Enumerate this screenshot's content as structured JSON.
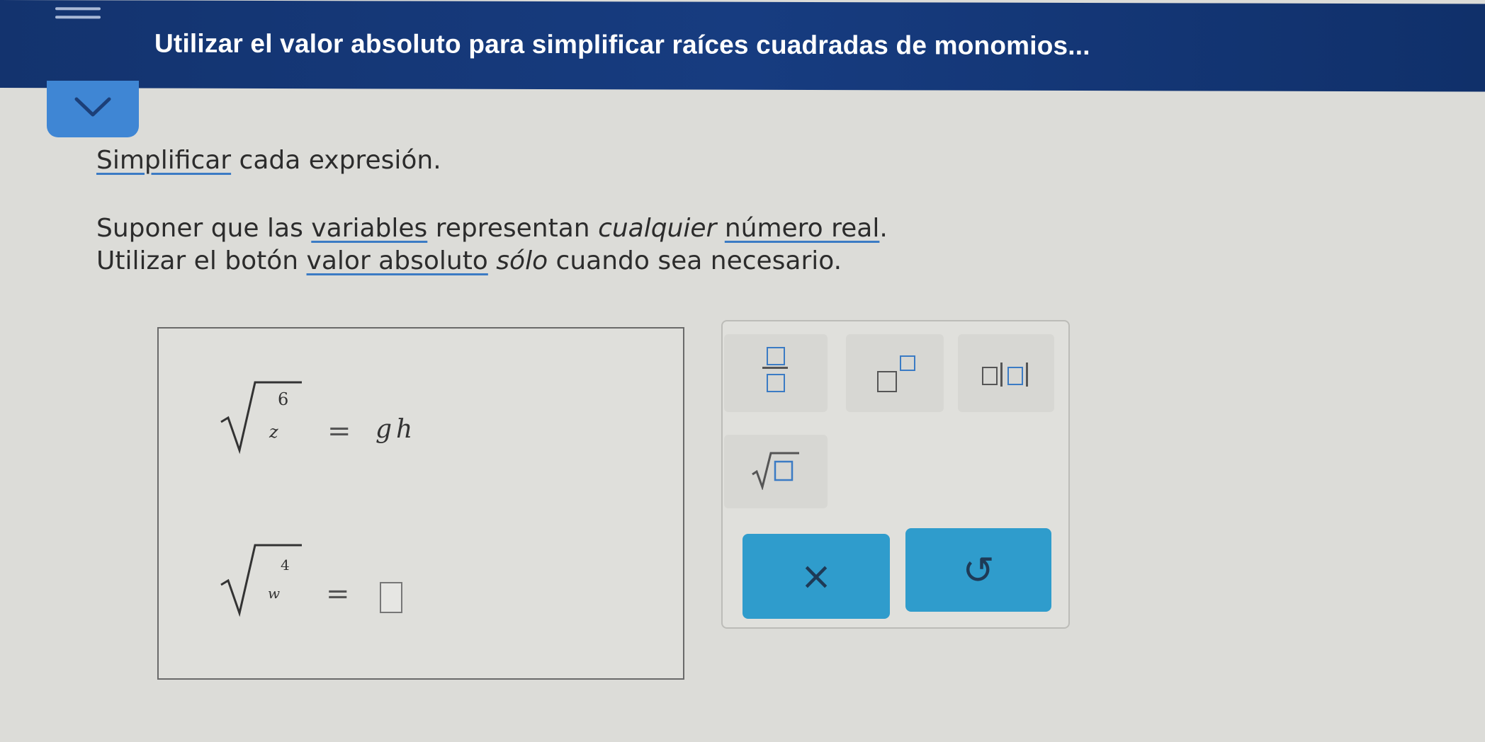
{
  "header": {
    "title": "Utilizar el valor absoluto para simplificar raíces cuadradas de monomios..."
  },
  "instructions": {
    "line1": {
      "link": "Simplificar",
      "rest": " cada expresión."
    },
    "line2": {
      "pre": "Suponer que las ",
      "link1": "variables",
      "mid1": " representan ",
      "italic": "cualquier",
      "mid2": " ",
      "link2": "número real",
      "end": "."
    },
    "line3": {
      "pre": "Utilizar el botón ",
      "link": "valor absoluto",
      "mid": " ",
      "italic": "sólo",
      "end": " cuando sea necesario."
    }
  },
  "problems": [
    {
      "variable": "z",
      "exponent": "6",
      "equals": "=",
      "answer": "gh"
    },
    {
      "variable": "w",
      "exponent": "4",
      "equals": "=",
      "answer": ""
    }
  ],
  "palette": {
    "buttons": [
      "fraction",
      "exponent",
      "absolute-value",
      "square-root"
    ],
    "clear_symbol": "×",
    "undo_symbol": "↺"
  },
  "colors": {
    "header": "#173c80",
    "accent": "#3f86d4",
    "action": "#2f9ccc"
  }
}
